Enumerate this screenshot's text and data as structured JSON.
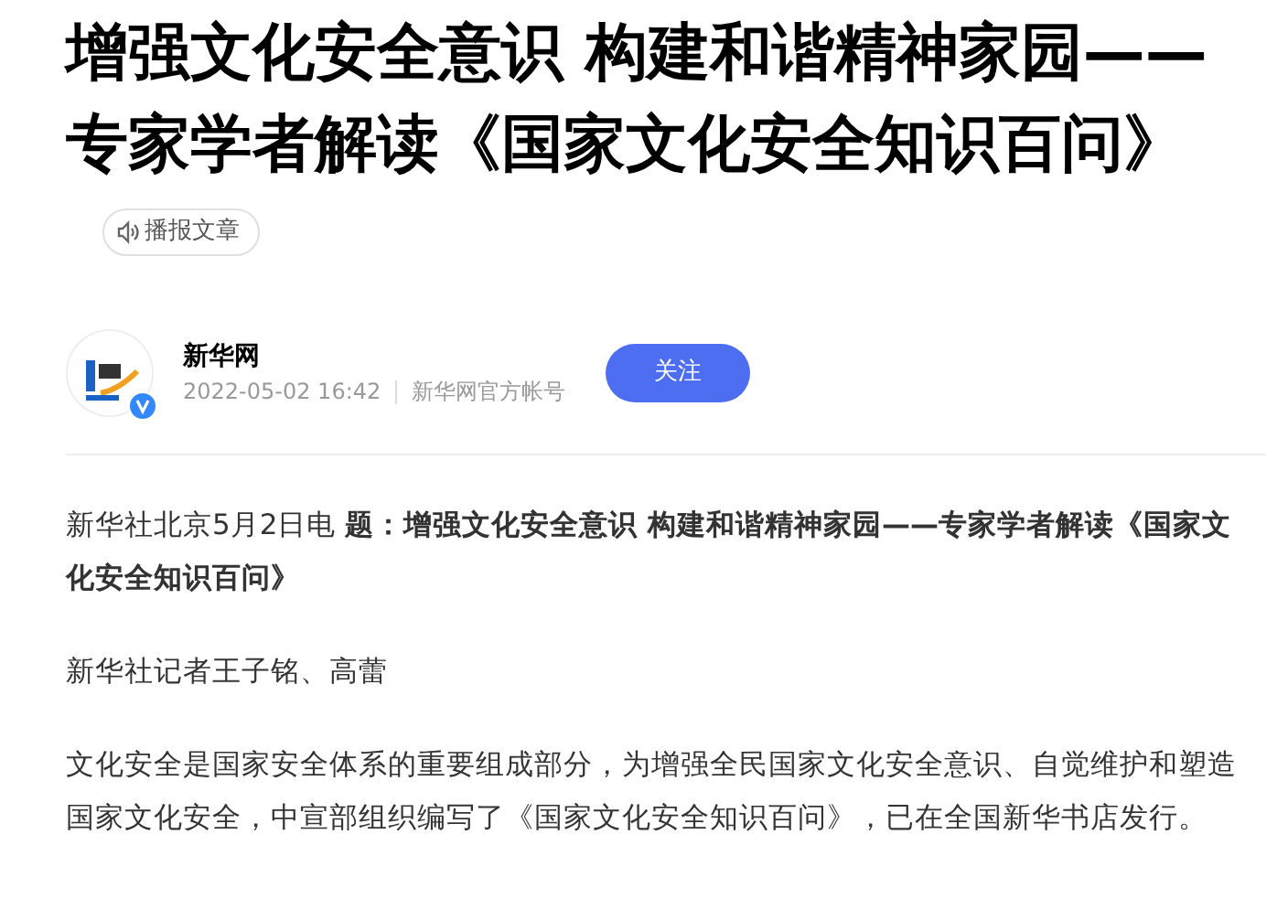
{
  "article": {
    "title": "增强文化安全意识 构建和谐精神家园——专家学者解读《国家文化安全知识百问》",
    "listen_button": "播报文章"
  },
  "author": {
    "name": "新华网",
    "verified": true,
    "time": "2022-05-02 16:42",
    "account": "新华网官方帐号",
    "follow_button": "关注"
  },
  "paragraphs": [
    "新华社北京5月2日电 **题：增强文化安全意识 构建和谐精神家园——专家学者解读《国家文化安全知识百问》**",
    "新华社记者王子铭、高蕾",
    "文化安全是国家安全体系的重要组成部分，为增强全民国家文化安全意识、自觉维护和塑造国家文化安全，中宣部组织编写了《国家文化安全知识百问》，已在全国新华书店发行。"
  ]
}
